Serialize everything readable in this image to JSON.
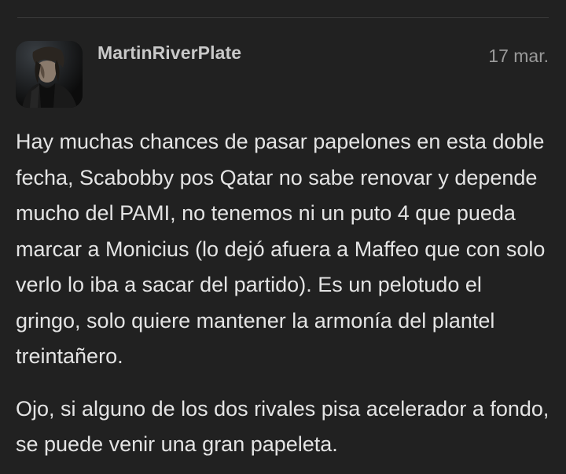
{
  "post": {
    "username": "MartinRiverPlate",
    "date": "17 mar.",
    "avatar_icon": "user-avatar-image",
    "paragraphs": [
      "Hay muchas chances de pasar papelones en esta doble fecha, Scabobby pos Qatar no sabe renovar y depende mucho del PAMI, no tenemos ni un puto 4 que pueda marcar a Monicius (lo dejó afuera a Maffeo que con solo verlo lo iba a sacar del partido). Es un pelotudo el gringo, solo quiere mantener la armonía del plantel treintañero.",
      "Ojo, si alguno de los dos rivales pisa acelerador a fondo, se puede venir una gran papeleta."
    ]
  },
  "colors": {
    "background": "#212121",
    "text": "#e4e4e4",
    "username": "#c9c9c9",
    "date": "#9a9a9a"
  }
}
